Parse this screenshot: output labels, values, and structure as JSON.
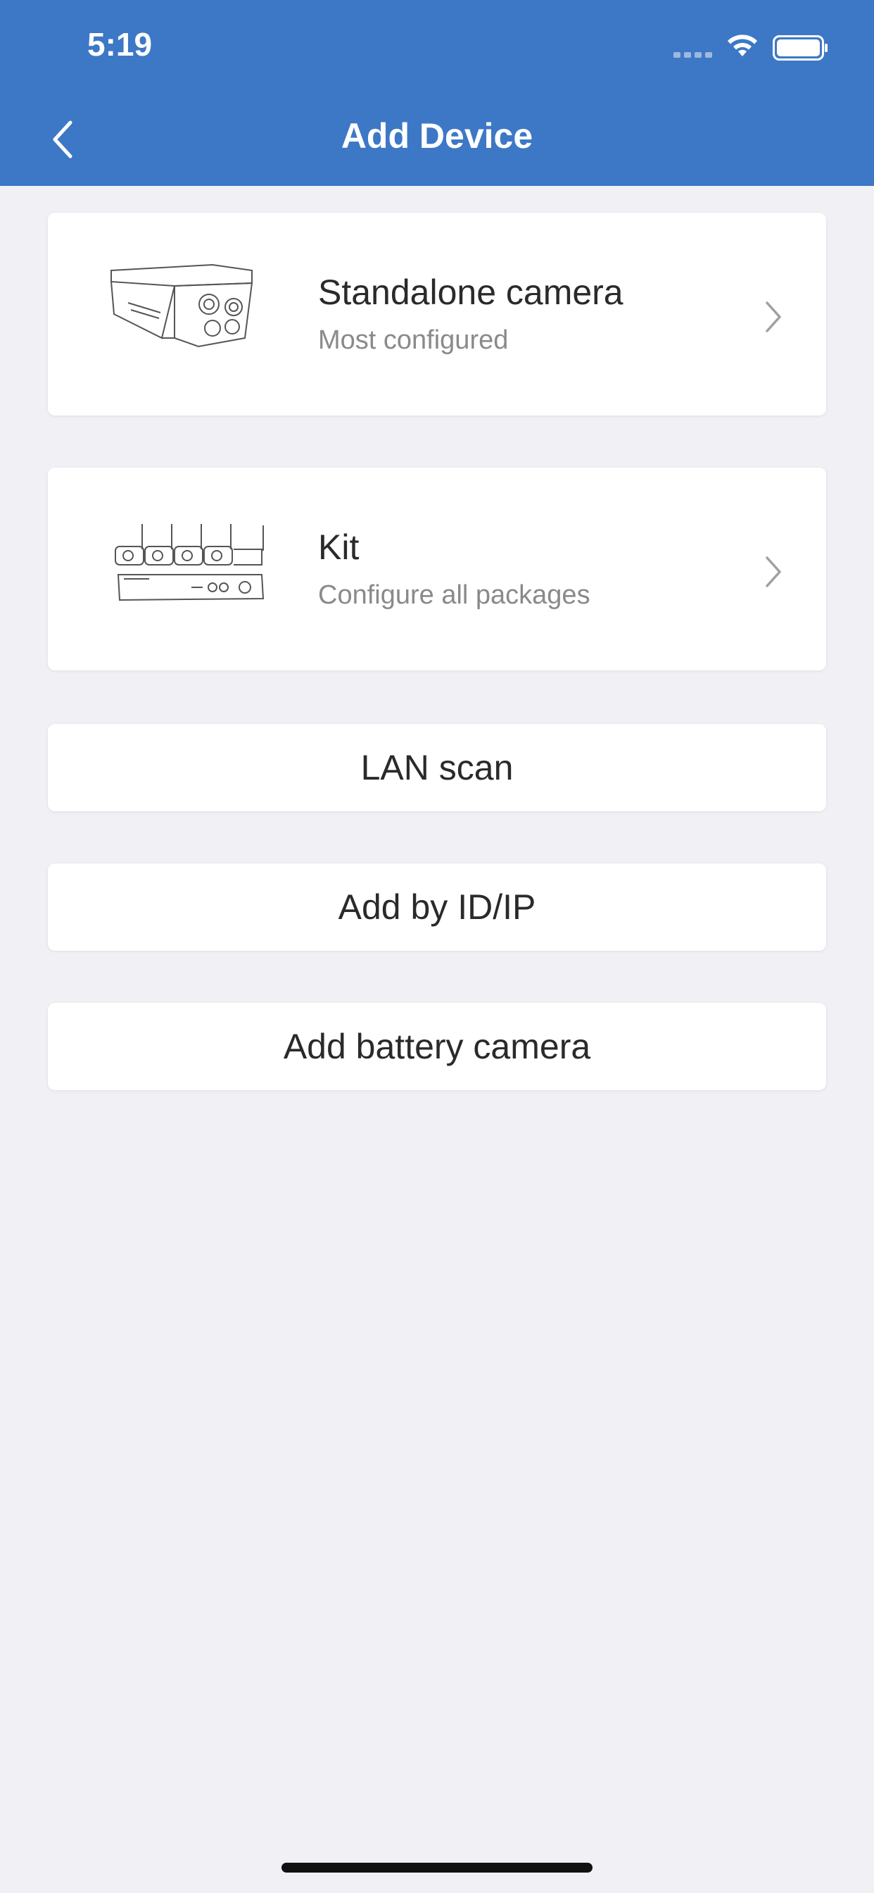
{
  "status_bar": {
    "time": "5:19"
  },
  "nav": {
    "title": "Add Device",
    "back_icon": "chevron-left-icon"
  },
  "options": [
    {
      "title": "Standalone camera",
      "subtitle": "Most configured",
      "icon": "bullet-camera-icon"
    },
    {
      "title": "Kit",
      "subtitle": "Configure all packages",
      "icon": "camera-kit-icon"
    }
  ],
  "buttons": {
    "lan_scan": "LAN scan",
    "add_by_id": "Add by ID/IP",
    "add_battery": "Add battery camera"
  },
  "colors": {
    "header": "#3d78c6",
    "background": "#f0f0f5"
  }
}
